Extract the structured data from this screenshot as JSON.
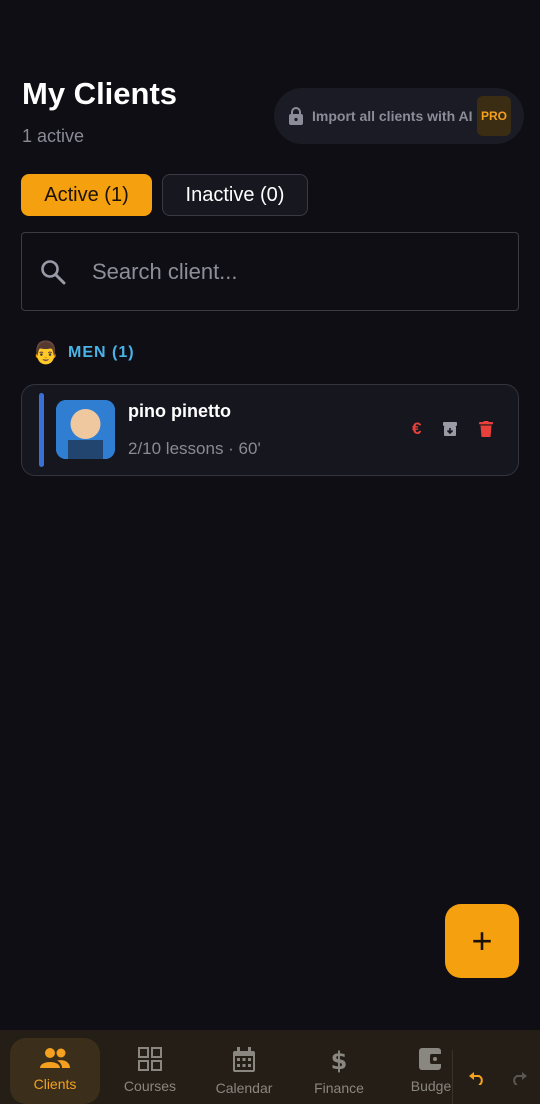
{
  "header": {
    "title": "My Clients",
    "subtitle": "1 active"
  },
  "import": {
    "label": "Import all clients with AI",
    "badge": "PRO"
  },
  "tabs": [
    {
      "label": "Active (1)",
      "active": true
    },
    {
      "label": "Inactive (0)",
      "active": false
    }
  ],
  "search": {
    "placeholder": "Search client...",
    "value": ""
  },
  "group": {
    "emoji": "👨",
    "label": "MEN (1)"
  },
  "clients": [
    {
      "name": "pino pinetto",
      "meta": "2/10 lessons · 60'",
      "payment_symbol": "€"
    }
  ],
  "fab": {
    "symbol": "+"
  },
  "nav": [
    {
      "label": "Clients",
      "icon": "people-icon",
      "active": true
    },
    {
      "label": "Courses",
      "icon": "grid-icon",
      "active": false
    },
    {
      "label": "Calendar",
      "icon": "calendar-icon",
      "active": false
    },
    {
      "label": "Finance",
      "icon": "dollar-icon",
      "active": false
    },
    {
      "label": "Budge",
      "icon": "wallet-icon",
      "active": false
    }
  ],
  "colors": {
    "accent": "#f5a00f",
    "background": "#0e0e14",
    "group": "#4ab3e8",
    "danger": "#e8403a"
  }
}
